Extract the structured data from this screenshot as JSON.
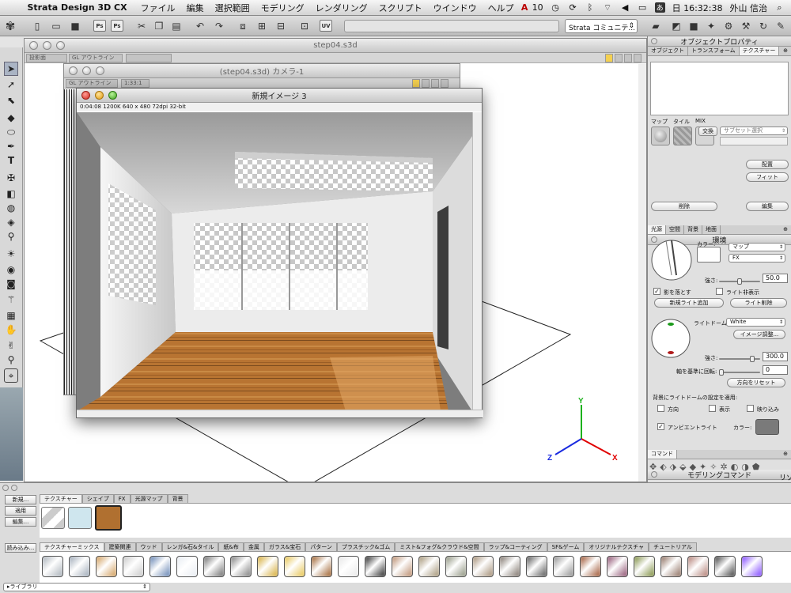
{
  "menubar": {
    "app": "Strata Design 3D CX",
    "items": [
      "ファイル",
      "編集",
      "選択範囲",
      "モデリング",
      "レンダリング",
      "スクリプト",
      "ウインドウ",
      "ヘルプ"
    ],
    "adobe": "10",
    "tray_letter": "あ",
    "clock": "日 16:32:38",
    "user": "外山 信治"
  },
  "toolbar": {
    "ps1": "Ps",
    "ps2": "Ps",
    "uv": "UV",
    "community": "Strata コミュニテ..."
  },
  "main_window": {
    "title": "step04.s3d",
    "selects": [
      "投影面",
      "GL アウトライン"
    ]
  },
  "camera_window": {
    "title": "(step04.s3d) カメラ-1",
    "selects": [
      "GL アウトライン",
      "1:33:1"
    ]
  },
  "render_window": {
    "title": "新規イメージ 3",
    "info": "0:04:08   1200K   640 x 480   72dpi   32-bit"
  },
  "axis": {
    "x": "X",
    "y": "Y",
    "z": "Z"
  },
  "object_properties": {
    "title": "オブジェクトプロパティ",
    "tabs": [
      "オブジェクト",
      "トランスフォーム",
      "テクスチャー"
    ],
    "map_labels": [
      "マップ",
      "タイル",
      "MIX"
    ],
    "exchange_label": "交換",
    "subset_select": "サブセット選択",
    "place_btn": "配置",
    "fit_btn": "フィット",
    "delete_btn": "削除",
    "edit_btn": "編集"
  },
  "environment": {
    "title": "環境",
    "tabs": [
      "光源",
      "空間",
      "背景",
      "地面"
    ],
    "color_label": "カラー:",
    "map_select": "マップ",
    "fx_select": "FX",
    "strength_label": "強さ:",
    "strength_value": "50.0",
    "strength_level": 0.5,
    "cast_shadow": "影を落とす",
    "cast_shadow_checked": true,
    "hide_light": "ライト非表示",
    "hide_light_checked": false,
    "add_light_btn": "新規ライト追加",
    "delete_light_btn": "ライト削除",
    "lightdome_label": "ライトドーム:",
    "lightdome_select": "White",
    "image_adjust_btn": "イメージ調整...",
    "strength2_label": "強さ:",
    "strength2_value": "300.0",
    "strength2_level": 0.85,
    "rotate_label": "軸を基準に回転:",
    "rotate_value": "0",
    "rotate_level": 0.0,
    "reset_btn": "方向をリセット",
    "apply_label": "背景にライトドームの設定を適用:",
    "apply_opts": [
      "方向",
      "表示",
      "映り込み"
    ],
    "ambient_label": "アンビエントライト",
    "ambient_checked": true,
    "ambient_color_label": "カラー:",
    "ambient_color": "#7a7a7a"
  },
  "modeling_commands": {
    "title": "モデリングコマンド",
    "tab": "コマンド",
    "clip": "リソ"
  },
  "library": {
    "left_buttons": [
      "新規...",
      "適用",
      "編集...",
      "読み込み..."
    ],
    "top_tabs": [
      "テクスチャー",
      "シェイプ",
      "FX",
      "光源マップ",
      "背景"
    ],
    "categories": [
      "テクスチャーミックス",
      "建築関連",
      "ウッド",
      "レンガ&石&タイル",
      "紙&布",
      "金属",
      "ガラス&宝石",
      "パターン",
      "プラスチック&ゴム",
      "ミスト&フォグ&クラウド&空間",
      "ラップ&コーティング",
      "SF&ゲーム",
      "オリジナルテクスチャ",
      "チュートリアル"
    ],
    "library_label": "ライブラリ",
    "swatch_colors": [
      "#a8b0b8",
      "#9ca8b6",
      "#d09a55",
      "#c8c8c8",
      "#5f7fb0",
      "#e8ecf2",
      "#6a6a6a",
      "#7a7a7a",
      "#d4a930",
      "#e6c24a",
      "#9a5a24",
      "#e8e8e8",
      "#222222",
      "#b98a6a",
      "#a09070",
      "#8a8f7a",
      "#a08a70",
      "#7a6f66",
      "#505050",
      "#8d8d8d",
      "#9a4e2a",
      "#8a4a6a",
      "#7a8a3a",
      "#8a6a5a",
      "#b07a70",
      "#3a3a3a",
      "#7b40ff"
    ]
  }
}
